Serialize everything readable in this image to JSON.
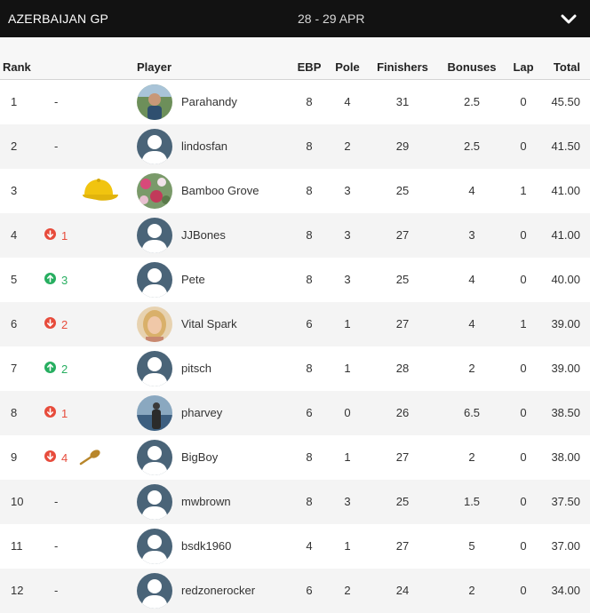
{
  "header": {
    "title": "AZERBAIJAN GP",
    "dates": "28 - 29 APR",
    "toggle_icon": "chevron-down-icon"
  },
  "columns": {
    "rank": "Rank",
    "player": "Player",
    "ebp": "EBP",
    "pole": "Pole",
    "finishers": "Finishers",
    "bonuses": "Bonuses",
    "lap": "Lap",
    "total": "Total"
  },
  "colors": {
    "header_bg": "#121212",
    "down": "#e74c3c",
    "up": "#27ae60",
    "avatar_default": "#4a6478",
    "cap": "#f1c40f",
    "spoon": "#b8862b"
  },
  "rows": [
    {
      "rank": "1",
      "change": "-",
      "direction": "none",
      "award": "",
      "avatar": "photo-man-outdoors",
      "player": "Parahandy",
      "ebp": "8",
      "pole": "4",
      "finishers": "31",
      "bonuses": "2.5",
      "lap": "0",
      "total": "45.50"
    },
    {
      "rank": "2",
      "change": "-",
      "direction": "none",
      "award": "",
      "avatar": "default-user-icon",
      "player": "lindosfan",
      "ebp": "8",
      "pole": "2",
      "finishers": "29",
      "bonuses": "2.5",
      "lap": "0",
      "total": "41.50"
    },
    {
      "rank": "3",
      "change": "",
      "direction": "none",
      "award": "yellow-cap-icon",
      "avatar": "photo-flowers",
      "player": "Bamboo Grove",
      "ebp": "8",
      "pole": "3",
      "finishers": "25",
      "bonuses": "4",
      "lap": "1",
      "total": "41.00"
    },
    {
      "rank": "4",
      "change": "1",
      "direction": "down",
      "award": "",
      "avatar": "default-user-icon",
      "player": "JJBones",
      "ebp": "8",
      "pole": "3",
      "finishers": "27",
      "bonuses": "3",
      "lap": "0",
      "total": "41.00"
    },
    {
      "rank": "5",
      "change": "3",
      "direction": "up",
      "award": "",
      "avatar": "default-user-icon",
      "player": "Pete",
      "ebp": "8",
      "pole": "3",
      "finishers": "25",
      "bonuses": "4",
      "lap": "0",
      "total": "40.00"
    },
    {
      "rank": "6",
      "change": "2",
      "direction": "down",
      "award": "",
      "avatar": "photo-blonde-woman",
      "player": "Vital Spark",
      "ebp": "6",
      "pole": "1",
      "finishers": "27",
      "bonuses": "4",
      "lap": "1",
      "total": "39.00"
    },
    {
      "rank": "7",
      "change": "2",
      "direction": "up",
      "award": "",
      "avatar": "default-user-icon",
      "player": "pitsch",
      "ebp": "8",
      "pole": "1",
      "finishers": "28",
      "bonuses": "2",
      "lap": "0",
      "total": "39.00"
    },
    {
      "rank": "8",
      "change": "1",
      "direction": "down",
      "award": "",
      "avatar": "photo-man-by-water",
      "player": "pharvey",
      "ebp": "6",
      "pole": "0",
      "finishers": "26",
      "bonuses": "6.5",
      "lap": "0",
      "total": "38.50"
    },
    {
      "rank": "9",
      "change": "4",
      "direction": "down",
      "award": "wooden-spoon-icon",
      "avatar": "default-user-icon",
      "player": "BigBoy",
      "ebp": "8",
      "pole": "1",
      "finishers": "27",
      "bonuses": "2",
      "lap": "0",
      "total": "38.00"
    },
    {
      "rank": "10",
      "change": "-",
      "direction": "none",
      "award": "",
      "avatar": "default-user-icon",
      "player": "mwbrown",
      "ebp": "8",
      "pole": "3",
      "finishers": "25",
      "bonuses": "1.5",
      "lap": "0",
      "total": "37.50"
    },
    {
      "rank": "11",
      "change": "-",
      "direction": "none",
      "award": "",
      "avatar": "default-user-icon",
      "player": "bsdk1960",
      "ebp": "4",
      "pole": "1",
      "finishers": "27",
      "bonuses": "5",
      "lap": "0",
      "total": "37.00"
    },
    {
      "rank": "12",
      "change": "-",
      "direction": "none",
      "award": "",
      "avatar": "default-user-icon",
      "player": "redzonerocker",
      "ebp": "6",
      "pole": "2",
      "finishers": "24",
      "bonuses": "2",
      "lap": "0",
      "total": "34.00"
    }
  ]
}
